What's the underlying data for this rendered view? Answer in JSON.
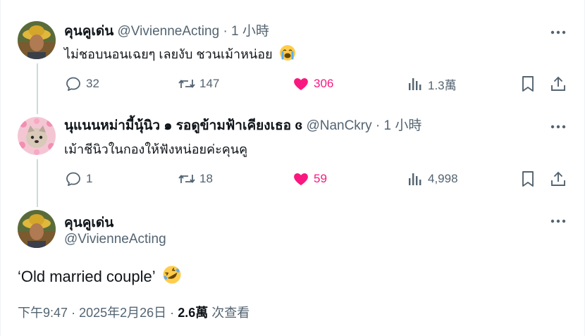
{
  "replies": [
    {
      "name": "คุนคูเด่น",
      "handle": "@VivienneActing",
      "separator": "·",
      "time": "1 小時",
      "text": "ไม่ชอบนอนเฉยๆ เลยงับ ชวนเม้าหน่อย",
      "emoji_icon": "loudly-crying-face-icon",
      "replies_count": "32",
      "reposts_count": "147",
      "likes_count": "306",
      "views_count": "1.3萬",
      "liked": true
    },
    {
      "name": "นุแนนหม่ามี้นุ้นิว ๑ รอดูข้ามฟ้าเคียงเธอ ɞ",
      "handle": "@NanCkry",
      "separator": "·",
      "time": "1 小時",
      "text": "เม้าชีนิวในกองให้ฟังหน่อยค่ะคุนคู",
      "replies_count": "1",
      "reposts_count": "18",
      "likes_count": "59",
      "views_count": "4,998",
      "liked": true
    }
  ],
  "main_tweet": {
    "name": "คุนคูเด่น",
    "handle": "@VivienneActing",
    "text": "‘Old married couple’",
    "emoji_icon": "rolling-on-floor-laughing-icon",
    "time": "下午9:47",
    "date": "2025年2月26日",
    "separator": "·",
    "views_count": "2.6萬",
    "views_label": "次查看"
  },
  "colors": {
    "like_pink": "#f91880",
    "secondary_text": "#536471",
    "primary_text": "#0f1419",
    "thread_line": "#cfd9de"
  }
}
